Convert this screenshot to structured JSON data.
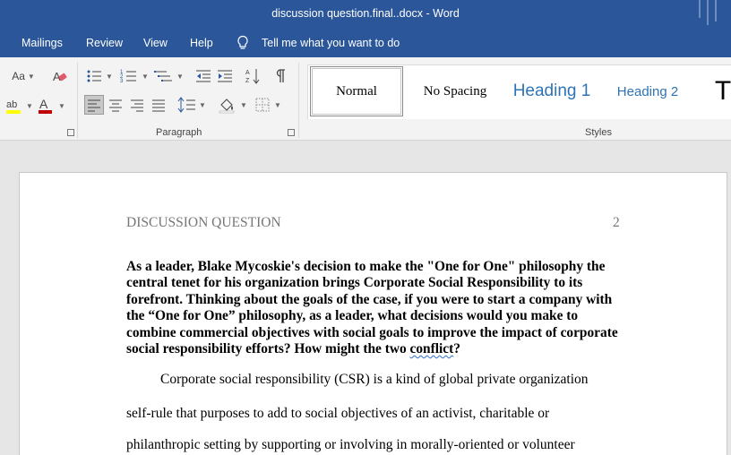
{
  "window": {
    "title": "discussion question.final..docx  -  Word"
  },
  "menu": {
    "items": [
      "Mailings",
      "Review",
      "View",
      "Help"
    ],
    "tell_me": "Tell me what you want to do"
  },
  "ribbon": {
    "font_case_label": "Aa",
    "paragraph_label": "Paragraph",
    "styles_label": "Styles",
    "styles": [
      "Normal",
      "No Spacing",
      "Heading 1",
      "Heading 2",
      "T"
    ],
    "selected_style": "Normal"
  },
  "document": {
    "running_head": "DISCUSSION QUESTION",
    "page_number": "2",
    "question_main": "As a leader, Blake Mycoskie's decision to make the \"One for One\" philosophy the central tenet for his organization brings Corporate Social Responsibility to its forefront. Thinking about the goals of the case, if you were to start a company with the “One for One” philosophy, as a leader, what decisions would you make to combine commercial objectives with social goals to improve the impact of corporate social responsibility efforts? How might the two ",
    "question_flagged_word": "conflict",
    "question_end": "?",
    "body_lines": [
      "Corporate social responsibility (CSR) is a kind of global private organization",
      "self-rule that purposes to add to social objectives of an activist, charitable or",
      "philanthropic setting by supporting or involving in morally-oriented or volunteer"
    ]
  },
  "colors": {
    "title_bar": "#2b579a",
    "heading_blue": "#2e74b5",
    "ribbon_bg": "#f3f3f3",
    "doc_bg": "#e6e6e6"
  }
}
